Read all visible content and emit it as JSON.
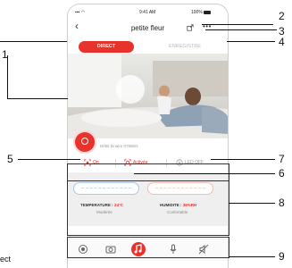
{
  "status": {
    "time": "9:41 AM",
    "battery": "100%"
  },
  "header": {
    "title": "petite fleur"
  },
  "tabs": [
    {
      "label": "DIRECT"
    },
    {
      "label": "ENREGISTRE"
    }
  ],
  "video": {
    "bitrate_text": "Débit binaire 0768b/s"
  },
  "controls": [
    {
      "label": "On"
    },
    {
      "label": "Activée"
    },
    {
      "label": "LED OFF"
    }
  ],
  "sensors": {
    "temperature_label": "TEMPERATURE :",
    "temperature_value": "24°C",
    "temperature_status": "Modérée",
    "humidity_label": "HUMIDITE :",
    "humidity_value": "36%RH",
    "humidity_status": "Confortable"
  },
  "annotations": {
    "n1": "1",
    "n2": "2",
    "n3": "3",
    "n4": "4",
    "n5": "5",
    "n6": "6",
    "n7": "7",
    "n8": "8",
    "n9": "9",
    "edge_text": "ect"
  },
  "colors": {
    "accent": "#e8322c",
    "temp_outline": "#aac8ea",
    "hum_outline": "#f3bdb4"
  }
}
